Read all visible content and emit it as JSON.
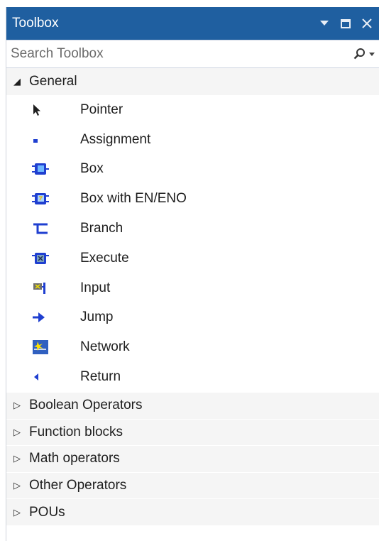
{
  "titlebar": {
    "title": "Toolbox",
    "dropdown_icon": "triangle-down-icon",
    "maximize_icon": "maximize-icon",
    "close_icon": "close-icon"
  },
  "search": {
    "placeholder": "Search Toolbox",
    "icon": "search-icon"
  },
  "general": {
    "label": "General",
    "expanded": true,
    "items": [
      {
        "label": "Pointer",
        "icon": "pointer-icon"
      },
      {
        "label": "Assignment",
        "icon": "assignment-icon"
      },
      {
        "label": "Box",
        "icon": "box-icon"
      },
      {
        "label": "Box with EN/ENO",
        "icon": "box-en-eno-icon"
      },
      {
        "label": "Branch",
        "icon": "branch-icon"
      },
      {
        "label": "Execute",
        "icon": "execute-icon"
      },
      {
        "label": "Input",
        "icon": "input-icon"
      },
      {
        "label": "Jump",
        "icon": "jump-icon"
      },
      {
        "label": "Network",
        "icon": "network-icon"
      },
      {
        "label": "Return",
        "icon": "return-icon"
      }
    ]
  },
  "categories": [
    {
      "label": "Boolean Operators"
    },
    {
      "label": "Function blocks"
    },
    {
      "label": "Math operators"
    },
    {
      "label": "Other Operators"
    },
    {
      "label": "POUs"
    }
  ],
  "colors": {
    "titlebar": "#1f5fa0",
    "icon_blue": "#1f4fd0",
    "category_bg": "#f5f5f5"
  }
}
